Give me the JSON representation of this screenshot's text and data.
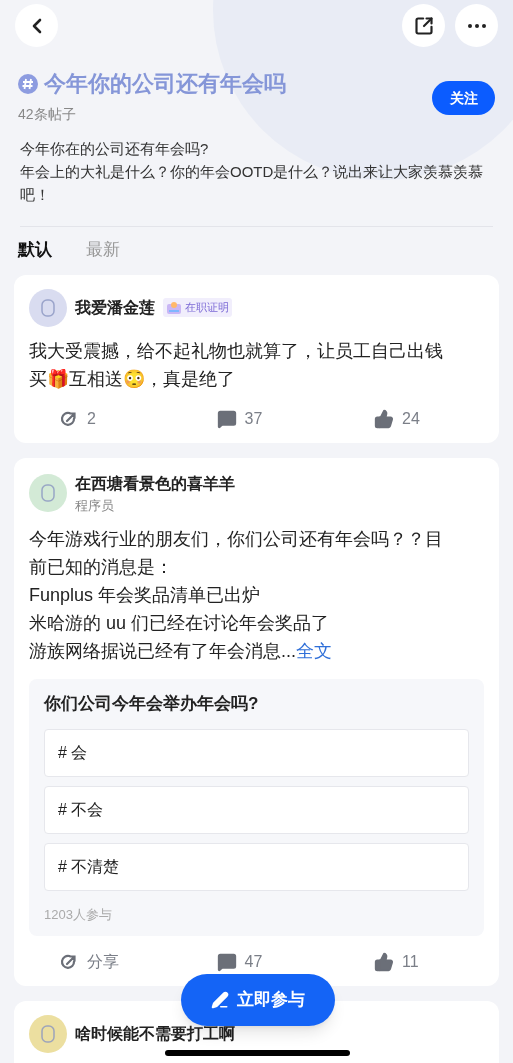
{
  "topic": {
    "title": "今年你的公司还有年会吗",
    "post_count": "42条帖子",
    "follow_button": "关注",
    "description": [
      "今年你在的公司还有年会吗?",
      "年会上的大礼是什么？你的年会OOTD是什么？说出来让大家羡慕羡慕吧！"
    ]
  },
  "tabs": [
    {
      "label": "默认",
      "selected": true
    },
    {
      "label": "最新",
      "selected": false
    }
  ],
  "posts": [
    {
      "author": "我爱潘金莲",
      "badge": "在职证明",
      "body": [
        "我大受震撼，给不起礼物也就算了，让员工自己出钱买🎁互相送😳，真是绝了"
      ],
      "stats": [
        {
          "kind": "share",
          "text": "2"
        },
        {
          "kind": "comment",
          "text": "37"
        },
        {
          "kind": "like",
          "text": "24"
        }
      ]
    },
    {
      "author": "在西塘看景色的喜羊羊",
      "subtitle": "程序员",
      "body": [
        "今年游戏行业的朋友们，你们公司还有年会吗？？目前已知的消息是：",
        "Funplus 年会奖品清单已出炉",
        "米哈游的 uu 们已经在讨论年会奖品了",
        "游族网络据说已经有了年会消息..."
      ],
      "more_link": "全文",
      "poll": {
        "question": "你们公司今年会举办年会吗?",
        "options": [
          "# 会",
          "# 不会",
          "# 不清楚"
        ],
        "participants": "1203人参与"
      },
      "stats": [
        {
          "kind": "share",
          "text": "分享"
        },
        {
          "kind": "comment",
          "text": "47"
        },
        {
          "kind": "like",
          "text": "11"
        }
      ]
    },
    {
      "author": "啥时候能不需要打工啊"
    }
  ],
  "fab": {
    "label": "立即参与"
  }
}
